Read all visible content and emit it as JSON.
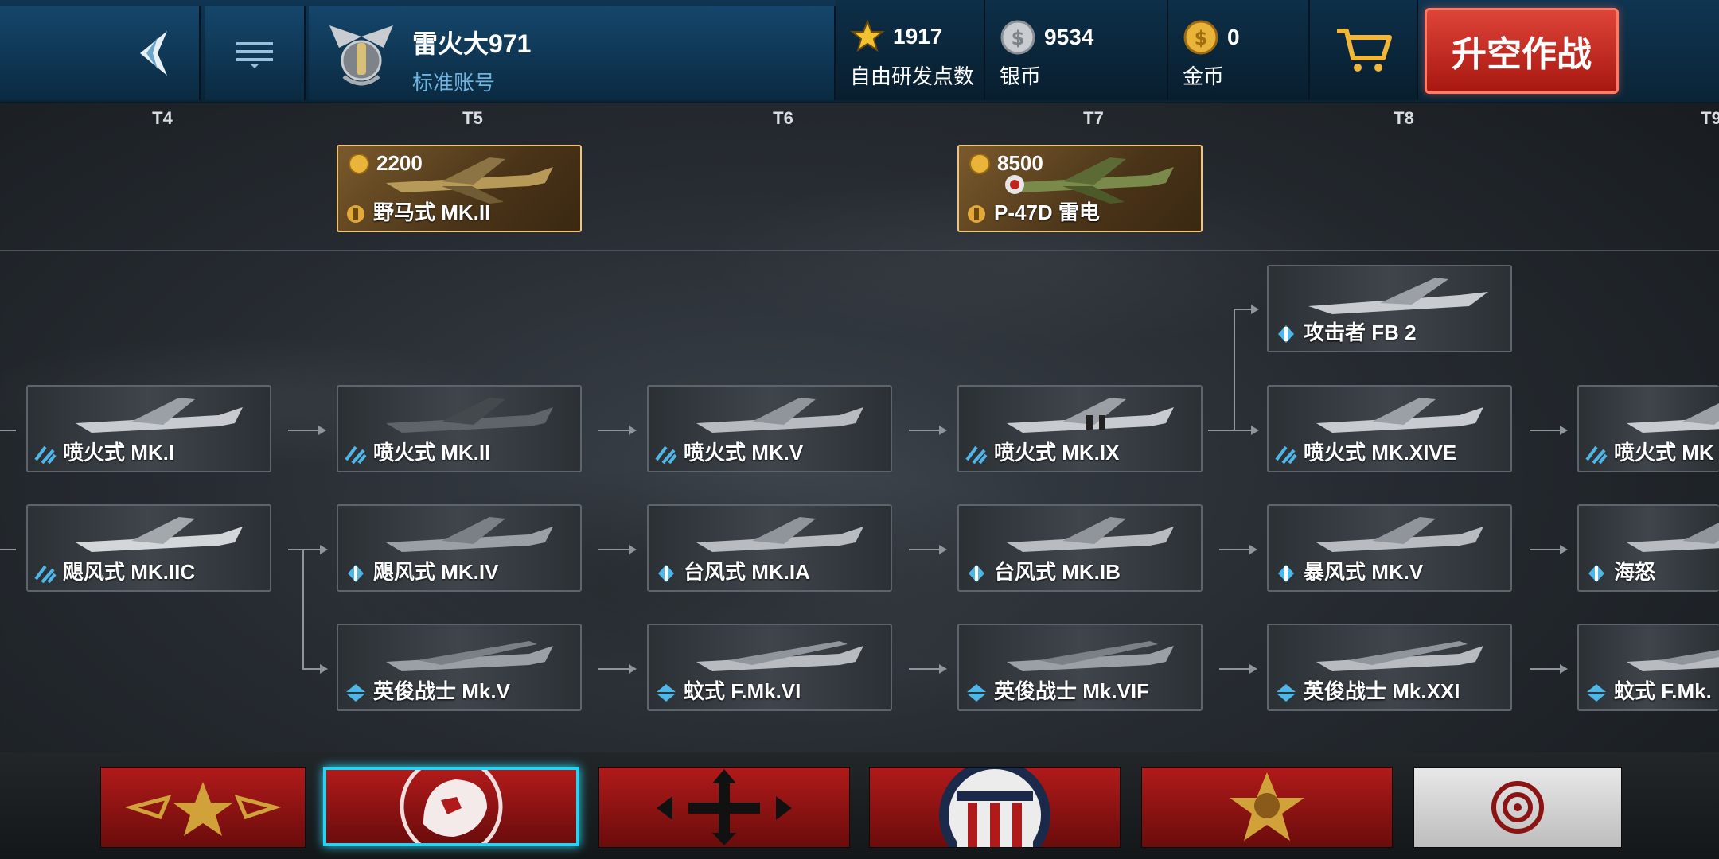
{
  "player": {
    "name": "雷火大971",
    "account_type": "标准账号"
  },
  "stats": [
    {
      "value": "1917",
      "label": "自由研发点数",
      "icon": "star-icon"
    },
    {
      "value": "9534",
      "label": "银币",
      "icon": "silver-coin-icon"
    },
    {
      "value": "0",
      "label": "金币",
      "icon": "gold-coin-icon"
    }
  ],
  "buttons": {
    "fly": "升空作战"
  },
  "tiers": [
    "T4",
    "T5",
    "T6",
    "T7",
    "T8",
    "T9"
  ],
  "premium": [
    {
      "cost": "2200",
      "name": "野马式 MK.II"
    },
    {
      "cost": "8500",
      "name": "P-47D 雷电"
    }
  ],
  "tree": {
    "row_top": [
      "攻击者 FB 2"
    ],
    "row1": [
      "喷火式 MK.I",
      "喷火式 MK.II",
      "喷火式 MK.V",
      "喷火式 MK.IX",
      "喷火式 MK.XIVE",
      "喷火式 MK"
    ],
    "row2": [
      "飓风式 MK.IIC",
      "飓风式 MK.IV",
      "台风式 MK.IA",
      "台风式 MK.IB",
      "暴风式 MK.V",
      "海怒"
    ],
    "row3": [
      "英俊战士 Mk.V",
      "蚊式 F.Mk.VI",
      "英俊战士 Mk.VIF",
      "英俊战士 Mk.XXI",
      "蚊式 F.Mk."
    ]
  },
  "nations": [
    {
      "icon": "soviet-star-icon",
      "selected": false
    },
    {
      "icon": "british-lion-icon",
      "selected": true
    },
    {
      "icon": "cross-arrows-icon",
      "selected": false
    },
    {
      "icon": "usa-shield-icon",
      "selected": false
    },
    {
      "icon": "bear-star-icon",
      "selected": false
    },
    {
      "icon": "japan-mitsudomoe-icon",
      "selected": false
    }
  ],
  "colors": {
    "accent_red": "#c0261c",
    "selected_cyan": "#27d3f2",
    "gold_border": "#f0c57a"
  }
}
